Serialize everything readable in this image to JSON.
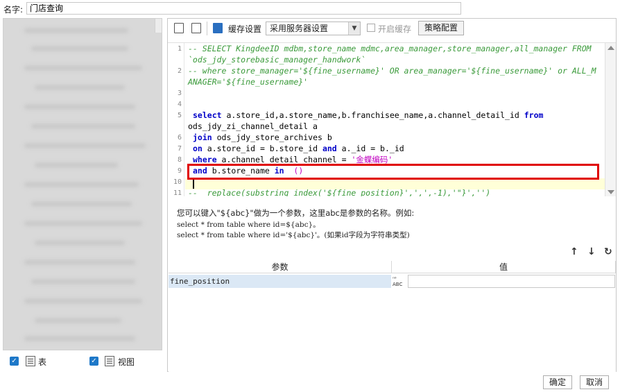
{
  "name_row": {
    "label": "名字:",
    "value": "门店查询"
  },
  "left_footer": {
    "table_label": "表",
    "view_label": "视图"
  },
  "toolbar": {
    "cache_label": "缓存设置",
    "cache_select_value": "采用服务器设置",
    "enable_cache_label": "开启缓存",
    "strategy_button": "策略配置"
  },
  "editor": {
    "line_numbers": [
      "1",
      "2",
      "3",
      "4",
      "5",
      "6",
      "7",
      "8",
      "9",
      "10",
      "11"
    ],
    "lines": {
      "l1a": "-- SELECT KingdeeID mdbm,store_name mdmc,area_manager,store_manager,all_manager FROM",
      "l1b": "`ods_jdy_storebasic_manager_handwork`",
      "l2a": "-- where store_manager='${fine_username}' OR area_manager='${fine_username}' or ALL_M",
      "l2b": "ANAGER='${fine_username}'",
      "l5a_kw": "select",
      "l5a_rest": " a.store_id,a.store_name,b.franchisee_name,a.channel_detail_id ",
      "l5a_kw2": "from",
      "l5b": "ods_jdy_zi_channel_detail a",
      "l6_kw": "join",
      "l6_rest": " ods_jdy_store_archives b",
      "l7_kw": "on",
      "l7_mid": " a.store_id = b.store_id ",
      "l7_kw2": "and",
      "l7_rest": " a._id = b._id",
      "l8_kw": "where",
      "l8_mid": " a.channel_detail_channel = ",
      "l8_str": "'金蝶编码'",
      "l9_kw": "and",
      "l9_mid": " b.store_name ",
      "l9_kw2": "in",
      "l9_str": "  ()",
      "l11": "--  replace(substring_index('${fine_position}',',',-1),'\"}','')"
    }
  },
  "hint": {
    "line1": "您可以键入\"${abc}\"做为一个参数，这里abc是参数的名称。例如:",
    "line2": "select * from table where id=${abc}。",
    "line3": "select * from table where id='${abc}'。(如果id字段为字符串类型)"
  },
  "param_table": {
    "col_param": "参数",
    "col_value": "值",
    "row_name": "fine_position",
    "type_icon_top": "ⁿ⁰",
    "type_icon_bottom": "ABC"
  },
  "buttons": {
    "ok": "确定",
    "cancel": "取消"
  },
  "icons": {
    "up_arrow": "↑",
    "down_arrow": "↓",
    "refresh": "↻",
    "check": "✓"
  }
}
